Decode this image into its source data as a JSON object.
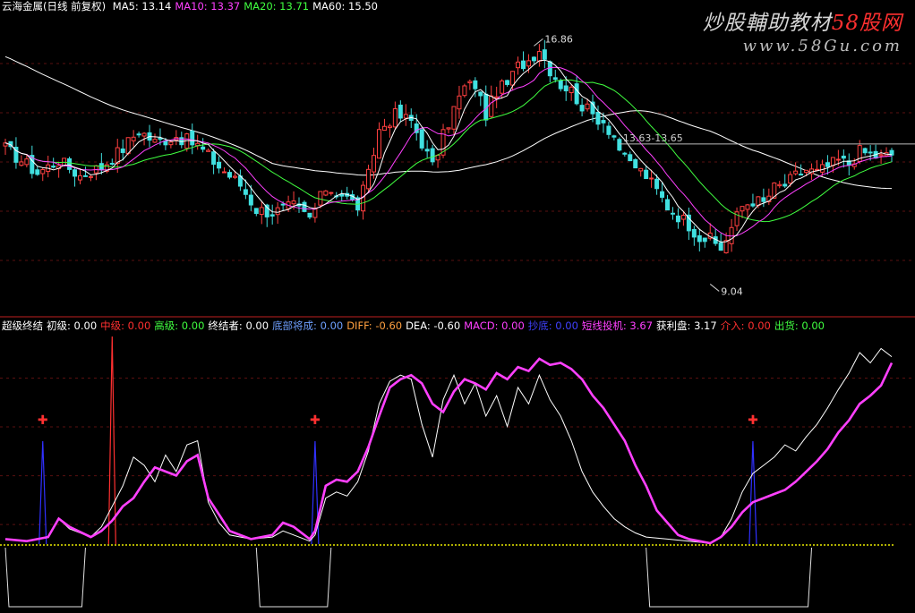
{
  "top_legend": {
    "title": "云海金属(日线 前复权)",
    "items": [
      {
        "label": "MA5:",
        "value": "13.14",
        "color": "#ffffff"
      },
      {
        "label": "MA10:",
        "value": "13.37",
        "color": "#ff40ff"
      },
      {
        "label": "MA20:",
        "value": "13.71",
        "color": "#40ff40"
      },
      {
        "label": "MA60:",
        "value": "15.50",
        "color": "#ffffff"
      }
    ]
  },
  "bottom_legend": {
    "items": [
      {
        "label": "超级终结",
        "value": "",
        "color": "#ffffff"
      },
      {
        "label": "初级:",
        "value": "0.00",
        "color": "#ffffff"
      },
      {
        "label": "中级:",
        "value": "0.00",
        "color": "#ff3030"
      },
      {
        "label": "高级:",
        "value": "0.00",
        "color": "#40ff40"
      },
      {
        "label": "终结者:",
        "value": "0.00",
        "color": "#ffffff"
      },
      {
        "label": "底部将成:",
        "value": "0.00",
        "color": "#6fa0ff"
      },
      {
        "label": "DIFF:",
        "value": "-0.60",
        "color": "#ffa040"
      },
      {
        "label": "DEA:",
        "value": "-0.60",
        "color": "#ffffff"
      },
      {
        "label": "MACD:",
        "value": "0.00",
        "color": "#ff40ff"
      },
      {
        "label": "抄底:",
        "value": "0.00",
        "color": "#4040ff"
      },
      {
        "label": "短线投机:",
        "value": "3.67",
        "color": "#ff40ff"
      },
      {
        "label": "获利盘:",
        "value": "3.17",
        "color": "#ffffff"
      },
      {
        "label": "介入:",
        "value": "0.00",
        "color": "#ff3030"
      },
      {
        "label": "出货:",
        "value": "0.00",
        "color": "#40ff40"
      }
    ]
  },
  "watermark": {
    "line1_a": "炒股輔助教材",
    "line1_b": "58股网",
    "line2": "www.58Gu.com"
  },
  "chart_data": [
    {
      "type": "candlestick",
      "title": "云海金属(日线 前复权)",
      "x_unit": "bar index (daily)",
      "x_range": [
        0,
        166
      ],
      "ylim": [
        8.2,
        17.9
      ],
      "colors": {
        "up": "#ff4040",
        "down": "#40e0e0",
        "ma5": "#ffffff",
        "ma10": "#ff40ff",
        "ma20": "#40ff40",
        "ma60": "#ffffff"
      },
      "close_anchors": [
        [
          0,
          13.5
        ],
        [
          3,
          13.1
        ],
        [
          6,
          12.7
        ],
        [
          10,
          13.1
        ],
        [
          14,
          12.6
        ],
        [
          18,
          12.9
        ],
        [
          22,
          13.5
        ],
        [
          25,
          14.1
        ],
        [
          28,
          13.7
        ],
        [
          32,
          13.9
        ],
        [
          36,
          13.6
        ],
        [
          40,
          12.9
        ],
        [
          44,
          12.3
        ],
        [
          47,
          11.5
        ],
        [
          50,
          11.4
        ],
        [
          54,
          11.6
        ],
        [
          57,
          11.2
        ],
        [
          60,
          12.2
        ],
        [
          63,
          12.0
        ],
        [
          66,
          11.6
        ],
        [
          68,
          12.6
        ],
        [
          70,
          14.1
        ],
        [
          73,
          14.6
        ],
        [
          76,
          14.4
        ],
        [
          78,
          13.7
        ],
        [
          80,
          12.9
        ],
        [
          82,
          13.9
        ],
        [
          84,
          14.8
        ],
        [
          86,
          15.5
        ],
        [
          88,
          15.6
        ],
        [
          90,
          14.6
        ],
        [
          92,
          15.4
        ],
        [
          94,
          15.6
        ],
        [
          96,
          16.2
        ],
        [
          98,
          16.4
        ],
        [
          100,
          16.8
        ],
        [
          102,
          16.1
        ],
        [
          104,
          15.6
        ],
        [
          106,
          15.4
        ],
        [
          108,
          14.9
        ],
        [
          110,
          14.6
        ],
        [
          112,
          14.4
        ],
        [
          114,
          13.9
        ],
        [
          116,
          13.1
        ],
        [
          118,
          12.9
        ],
        [
          120,
          12.6
        ],
        [
          122,
          12.1
        ],
        [
          124,
          11.6
        ],
        [
          126,
          11.3
        ],
        [
          128,
          11.0
        ],
        [
          130,
          10.6
        ],
        [
          132,
          10.5
        ],
        [
          134,
          10.2
        ],
        [
          136,
          10.9
        ],
        [
          138,
          11.6
        ],
        [
          140,
          11.8
        ],
        [
          142,
          11.7
        ],
        [
          144,
          12.2
        ],
        [
          146,
          12.3
        ],
        [
          148,
          12.6
        ],
        [
          150,
          12.8
        ],
        [
          152,
          12.7
        ],
        [
          154,
          12.9
        ],
        [
          156,
          13.1
        ],
        [
          158,
          13.0
        ],
        [
          160,
          13.4
        ],
        [
          162,
          13.3
        ],
        [
          164,
          13.2
        ],
        [
          166,
          13.3
        ]
      ],
      "annotations": [
        {
          "label": "16.86",
          "price": 16.86,
          "bar": 99
        },
        {
          "label": "13.63-13.65",
          "price": 13.64,
          "bar": 115
        },
        {
          "label": "9.04",
          "price": 9.04,
          "bar": 132
        }
      ]
    },
    {
      "type": "line",
      "title": "超级终结",
      "ylim": [
        0,
        100
      ],
      "series": [
        {
          "name": "短线投机",
          "color": "#ff40ff",
          "points": [
            [
              0,
              2
            ],
            [
              4,
              1
            ],
            [
              8,
              3
            ],
            [
              10,
              12
            ],
            [
              12,
              8
            ],
            [
              16,
              3
            ],
            [
              18,
              6
            ],
            [
              20,
              11
            ],
            [
              22,
              18
            ],
            [
              24,
              22
            ],
            [
              26,
              30
            ],
            [
              28,
              37
            ],
            [
              30,
              35
            ],
            [
              32,
              33
            ],
            [
              34,
              40
            ],
            [
              36,
              43
            ],
            [
              38,
              22
            ],
            [
              40,
              14
            ],
            [
              42,
              6
            ],
            [
              46,
              2
            ],
            [
              50,
              4
            ],
            [
              52,
              10
            ],
            [
              54,
              8
            ],
            [
              57,
              2
            ],
            [
              58,
              6
            ],
            [
              60,
              28
            ],
            [
              62,
              31
            ],
            [
              64,
              30
            ],
            [
              66,
              35
            ],
            [
              68,
              47
            ],
            [
              70,
              62
            ],
            [
              72,
              76
            ],
            [
              74,
              80
            ],
            [
              76,
              82
            ],
            [
              78,
              78
            ],
            [
              80,
              68
            ],
            [
              82,
              64
            ],
            [
              84,
              74
            ],
            [
              86,
              80
            ],
            [
              88,
              78
            ],
            [
              90,
              75
            ],
            [
              92,
              83
            ],
            [
              94,
              80
            ],
            [
              96,
              86
            ],
            [
              98,
              84
            ],
            [
              100,
              90
            ],
            [
              102,
              87
            ],
            [
              104,
              88
            ],
            [
              106,
              85
            ],
            [
              108,
              80
            ],
            [
              110,
              72
            ],
            [
              112,
              66
            ],
            [
              114,
              58
            ],
            [
              116,
              50
            ],
            [
              118,
              38
            ],
            [
              120,
              28
            ],
            [
              122,
              16
            ],
            [
              124,
              10
            ],
            [
              126,
              4
            ],
            [
              128,
              2
            ],
            [
              130,
              1
            ],
            [
              132,
              0
            ],
            [
              134,
              3
            ],
            [
              136,
              8
            ],
            [
              138,
              15
            ],
            [
              140,
              20
            ],
            [
              142,
              22
            ],
            [
              144,
              24
            ],
            [
              146,
              26
            ],
            [
              148,
              30
            ],
            [
              150,
              35
            ],
            [
              152,
              40
            ],
            [
              154,
              46
            ],
            [
              156,
              54
            ],
            [
              158,
              60
            ],
            [
              160,
              68
            ],
            [
              162,
              72
            ],
            [
              164,
              77
            ],
            [
              166,
              88
            ]
          ]
        },
        {
          "name": "获利盘",
          "color": "#ffffff",
          "points": [
            [
              0,
              2
            ],
            [
              4,
              1
            ],
            [
              8,
              3
            ],
            [
              10,
              12
            ],
            [
              12,
              7
            ],
            [
              16,
              3
            ],
            [
              18,
              8
            ],
            [
              20,
              18
            ],
            [
              22,
              28
            ],
            [
              24,
              42
            ],
            [
              26,
              38
            ],
            [
              28,
              30
            ],
            [
              30,
              43
            ],
            [
              32,
              35
            ],
            [
              34,
              48
            ],
            [
              36,
              50
            ],
            [
              38,
              20
            ],
            [
              40,
              10
            ],
            [
              42,
              4
            ],
            [
              46,
              2
            ],
            [
              50,
              3
            ],
            [
              52,
              6
            ],
            [
              54,
              4
            ],
            [
              57,
              1
            ],
            [
              58,
              4
            ],
            [
              60,
              22
            ],
            [
              62,
              25
            ],
            [
              64,
              23
            ],
            [
              66,
              30
            ],
            [
              68,
              45
            ],
            [
              70,
              68
            ],
            [
              72,
              79
            ],
            [
              74,
              82
            ],
            [
              76,
              80
            ],
            [
              78,
              58
            ],
            [
              80,
              42
            ],
            [
              82,
              70
            ],
            [
              84,
              82
            ],
            [
              86,
              68
            ],
            [
              88,
              78
            ],
            [
              90,
              62
            ],
            [
              92,
              72
            ],
            [
              94,
              57
            ],
            [
              96,
              76
            ],
            [
              98,
              68
            ],
            [
              100,
              82
            ],
            [
              102,
              70
            ],
            [
              104,
              62
            ],
            [
              106,
              50
            ],
            [
              108,
              35
            ],
            [
              110,
              25
            ],
            [
              112,
              18
            ],
            [
              114,
              12
            ],
            [
              116,
              8
            ],
            [
              118,
              5
            ],
            [
              120,
              3
            ],
            [
              124,
              2
            ],
            [
              128,
              1
            ],
            [
              132,
              0
            ],
            [
              134,
              3
            ],
            [
              136,
              12
            ],
            [
              138,
              25
            ],
            [
              140,
              34
            ],
            [
              142,
              38
            ],
            [
              144,
              42
            ],
            [
              146,
              48
            ],
            [
              148,
              45
            ],
            [
              150,
              52
            ],
            [
              152,
              58
            ],
            [
              154,
              66
            ],
            [
              156,
              75
            ],
            [
              158,
              83
            ],
            [
              160,
              93
            ],
            [
              162,
              88
            ],
            [
              164,
              95
            ],
            [
              166,
              91
            ]
          ]
        }
      ],
      "spikes": [
        {
          "name": "抄底",
          "color": "#3030ff",
          "bars": [
            7,
            58,
            140
          ],
          "height": 60
        },
        {
          "name": "中级",
          "color": "#ff3030",
          "bars": [
            20
          ],
          "height": 100
        }
      ],
      "markers": [
        {
          "symbol": "✚",
          "color": "#ff3030",
          "bars": [
            7,
            58,
            140
          ]
        }
      ],
      "bottom_zones": [
        [
          0,
          15
        ],
        [
          47,
          61
        ],
        [
          120,
          151
        ]
      ]
    }
  ]
}
